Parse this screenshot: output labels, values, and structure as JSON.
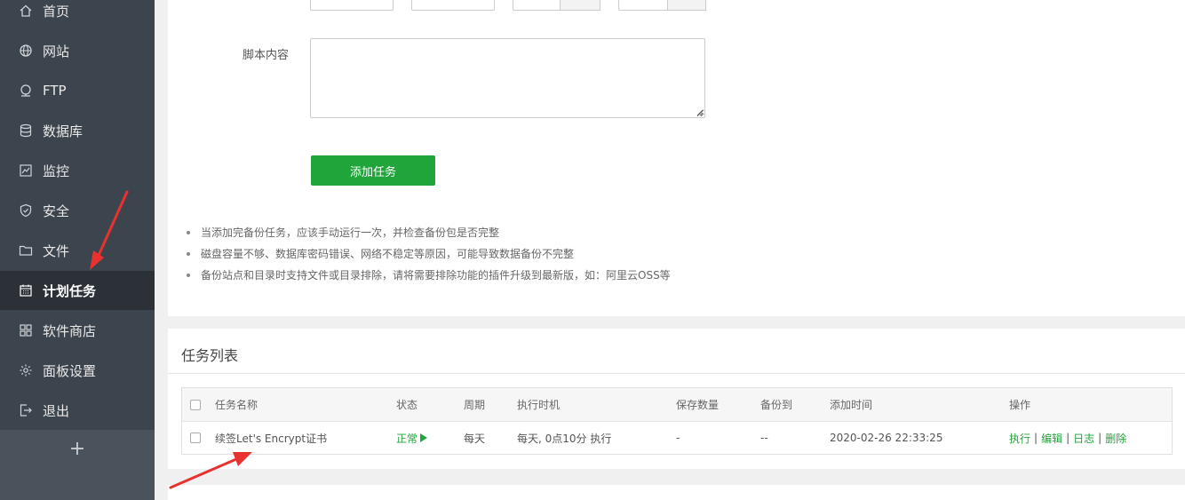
{
  "sidebar": {
    "items": [
      {
        "label": "首页",
        "icon": "home-icon"
      },
      {
        "label": "网站",
        "icon": "globe-icon"
      },
      {
        "label": "FTP",
        "icon": "ftp-icon"
      },
      {
        "label": "数据库",
        "icon": "database-icon"
      },
      {
        "label": "监控",
        "icon": "monitor-icon"
      },
      {
        "label": "安全",
        "icon": "shield-icon"
      },
      {
        "label": "文件",
        "icon": "folder-icon"
      },
      {
        "label": "计划任务",
        "icon": "calendar-icon",
        "active": true
      },
      {
        "label": "软件商店",
        "icon": "grid-icon"
      },
      {
        "label": "面板设置",
        "icon": "gear-icon"
      },
      {
        "label": "退出",
        "icon": "logout-icon"
      }
    ],
    "add_label": "+"
  },
  "form": {
    "script_label": "脚本内容",
    "script_value": "",
    "add_task_label": "添加任务"
  },
  "tips": [
    "当添加完备份任务，应该手动运行一次，并检查备份包是否完整",
    "磁盘容量不够、数据库密码错误、网络不稳定等原因，可能导致数据备份不完整",
    "备份站点和目录时支持文件或目录排除，请将需要排除功能的插件升级到最新版，如：阿里云OSS等"
  ],
  "task_list": {
    "title": "任务列表",
    "columns": [
      "任务名称",
      "状态",
      "周期",
      "执行时机",
      "保存数量",
      "备份到",
      "添加时间",
      "操作"
    ],
    "rows": [
      {
        "name": "续签Let's Encrypt证书",
        "status": "正常",
        "cycle": "每天",
        "timing": "每天, 0点10分 执行",
        "save_count": "-",
        "backup_to": "--",
        "added": "2020-02-26 22:33:25",
        "actions": [
          "执行",
          "编辑",
          "日志",
          "删除"
        ]
      }
    ]
  },
  "colors": {
    "sidebar_bg": "#3c444d",
    "sidebar_active": "#2c3138",
    "accent_green": "#20a53a",
    "annotation_red": "#e8322f"
  }
}
